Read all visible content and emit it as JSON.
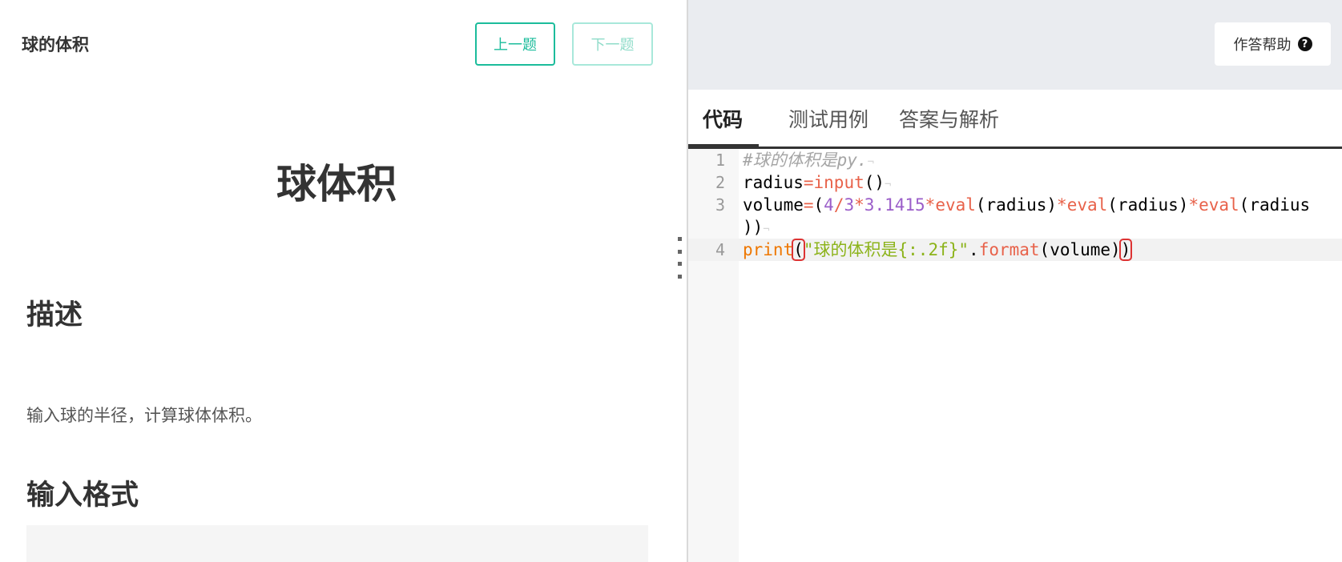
{
  "left": {
    "problem_name": "球的体积",
    "prev_label": "上一题",
    "next_label": "下一题",
    "title": "球体积",
    "description_heading": "描述",
    "description_text": "输入球的半径，计算球体体积。",
    "input_format_heading": "输入格式"
  },
  "right": {
    "help_label": "作答帮助",
    "help_icon": "question-circle-icon",
    "tabs": [
      "代码",
      "测试用例",
      "答案与解析"
    ],
    "active_tab": "代码"
  },
  "editor": {
    "line_numbers": [
      "1",
      "2",
      "3",
      "4"
    ],
    "lines": [
      "#球的体积是py.",
      "radius=input()",
      "volume=(4/3*3.1415*eval(radius)*eval(radius)*eval(radius))",
      "print(\"球的体积是{:.2f}\".format(volume))"
    ],
    "eol_marker": "¬"
  },
  "colors": {
    "accent": "#1bbc9b",
    "comment": "#a5a5a5",
    "keyword": "#ee7700",
    "builtin": "#e8624a",
    "number": "#9b5ec9",
    "string": "#8cb31a",
    "bracket_match": "#dd3333"
  }
}
